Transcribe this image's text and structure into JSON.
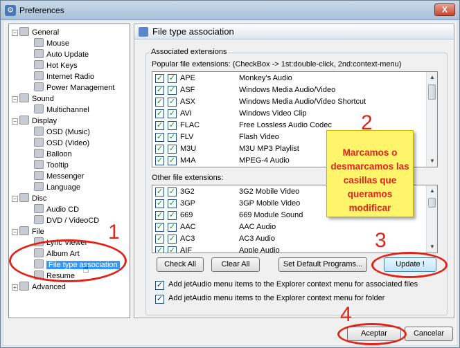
{
  "window": {
    "title": "Preferences",
    "close_label": "X"
  },
  "tree": {
    "items": [
      {
        "label": "General",
        "indent": 0
      },
      {
        "label": "Mouse",
        "indent": 1
      },
      {
        "label": "Auto Update",
        "indent": 1
      },
      {
        "label": "Hot Keys",
        "indent": 1
      },
      {
        "label": "Internet Radio",
        "indent": 1
      },
      {
        "label": "Power Management",
        "indent": 1
      },
      {
        "label": "Sound",
        "indent": 0
      },
      {
        "label": "Multichannel",
        "indent": 1
      },
      {
        "label": "Display",
        "indent": 0
      },
      {
        "label": "OSD (Music)",
        "indent": 1
      },
      {
        "label": "OSD (Video)",
        "indent": 1
      },
      {
        "label": "Balloon",
        "indent": 1
      },
      {
        "label": "Tooltip",
        "indent": 1
      },
      {
        "label": "Messenger",
        "indent": 1
      },
      {
        "label": "Language",
        "indent": 1
      },
      {
        "label": "Disc",
        "indent": 0
      },
      {
        "label": "Audio CD",
        "indent": 1
      },
      {
        "label": "DVD / VideoCD",
        "indent": 1
      },
      {
        "label": "File",
        "indent": 0
      },
      {
        "label": "Lyric Viewer",
        "indent": 1
      },
      {
        "label": "Album Art",
        "indent": 1
      },
      {
        "label": "File type association",
        "indent": 1,
        "selected": true
      },
      {
        "label": "Resume",
        "indent": 1
      },
      {
        "label": "Advanced",
        "indent": 0
      }
    ]
  },
  "panel": {
    "title": "File type association",
    "group_label": "Associated extensions",
    "popular_label": "Popular file extensions: (CheckBox -> 1st:double-click, 2nd:context-menu)",
    "popular": [
      {
        "ext": "APE",
        "desc": "Monkey's Audio"
      },
      {
        "ext": "ASF",
        "desc": "Windows Media Audio/Video"
      },
      {
        "ext": "ASX",
        "desc": "Windows Media Audio/Video Shortcut"
      },
      {
        "ext": "AVI",
        "desc": "Windows Video Clip"
      },
      {
        "ext": "FLAC",
        "desc": "Free Lossless Audio Codec"
      },
      {
        "ext": "FLV",
        "desc": "Flash Video"
      },
      {
        "ext": "M3U",
        "desc": "M3U MP3 Playlist"
      },
      {
        "ext": "M4A",
        "desc": "MPEG-4 Audio"
      }
    ],
    "other_label": "Other file extensions:",
    "other": [
      {
        "ext": "3G2",
        "desc": "3G2 Mobile Video"
      },
      {
        "ext": "3GP",
        "desc": "3GP Mobile Video"
      },
      {
        "ext": "669",
        "desc": "669 Module Sound"
      },
      {
        "ext": "AAC",
        "desc": "AAC Audio"
      },
      {
        "ext": "AC3",
        "desc": "AC3 Audio"
      },
      {
        "ext": "AIF",
        "desc": "Apple Audio"
      }
    ],
    "check_mark": "✓",
    "buttons": {
      "check_all": "Check All",
      "clear_all": "Clear All",
      "set_default": "Set Default Programs...",
      "update": "Update !"
    },
    "option1": "Add jetAudio menu items to the Explorer context menu for associated files",
    "option2": "Add jetAudio menu items to the Explorer context menu for folder"
  },
  "footer": {
    "ok": "Aceptar",
    "cancel": "Cancelar"
  },
  "annotations": {
    "n1": "1",
    "n2": "2",
    "n3": "3",
    "n4": "4",
    "note": "Marcamos o desmarcamos las casillas que queramos modificar"
  }
}
